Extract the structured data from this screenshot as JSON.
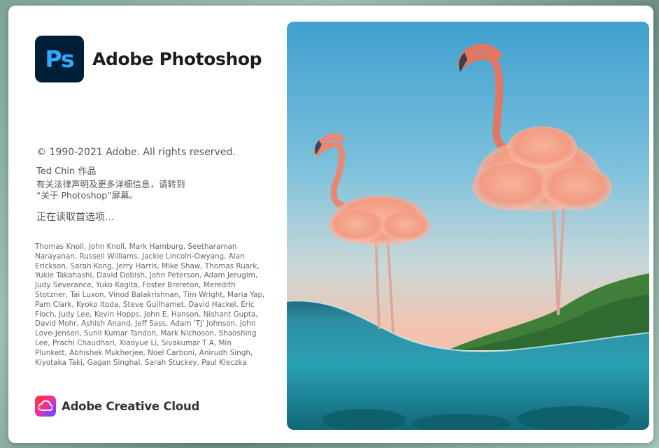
{
  "app": {
    "logo_text": "Ps",
    "name": "Adobe Photoshop"
  },
  "copyright": "© 1990-2021 Adobe. All rights reserved.",
  "artwork_credit": "Ted Chin 作品",
  "legal_notice": {
    "line1": "有关法律声明及更多详细信息，请转到",
    "line2": "“关于 Photoshop”屏幕。"
  },
  "loading_status": "正在读取首选项...",
  "credits": "Thomas Knoll, John Knoll, Mark Hamburg, Seetharaman Narayanan, Russell Williams, Jackie Lincoln-Owyang, Alan Erickson, Sarah Kong, Jerry Harris, Mike Shaw, Thomas Ruark, Yukie Takahashi, David Dobish, John Peterson, Adam Jerugim, Judy Severance, Yuko Kagita, Foster Brereton, Meredith Stotzner, Tai Luxon, Vinod Balakrishnan, Tim Wright, Maria Yap, Pam Clark, Kyoko Itoda, Steve Guilhamet, David Hackel, Eric Floch, Judy Lee, Kevin Hopps, John E. Hanson, Nishant Gupta, David Mohr, Ashish Anand, Jeff Sass, Adam 'TJ' Johnson, John Love-Jensen, Sunil Kumar Tandon, Mark Nichoson, Shaoshing Lee, Prachi Chaudhari, Xiaoyue Li, Sivakumar T A, Min Plunkett, Abhishek Mukherjee, Noel Carboni, Anirudh Singh, Kiyotaka Taki, Gagan Singhal, Sarah Stuckey, Paul Kleczka",
  "creative_cloud_label": "Adobe Creative Cloud",
  "colors": {
    "ps_logo_bg": "#001e36",
    "ps_logo_fg": "#31a8ff"
  },
  "icons": {
    "app_logo": "photoshop-logo-icon",
    "cc_logo": "creative-cloud-icon",
    "artwork": "flamingo-cloud-artwork"
  }
}
